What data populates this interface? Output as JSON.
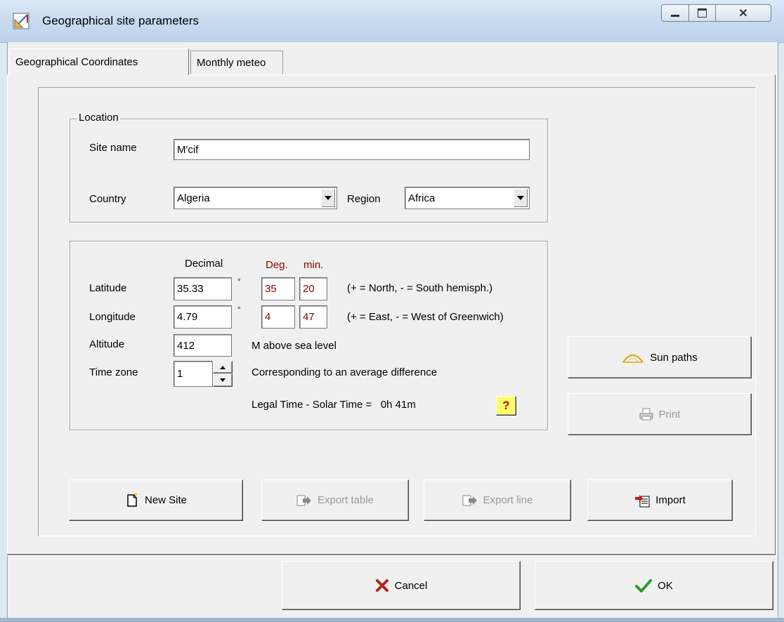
{
  "window": {
    "title": "Geographical site parameters",
    "controls": {
      "minimize": "minimize",
      "maximize": "maximize",
      "close": "close"
    }
  },
  "tabs": [
    {
      "label": "Geographical Coordinates",
      "active": true
    },
    {
      "label": "Monthly meteo",
      "active": false
    }
  ],
  "location": {
    "legend": "Location",
    "site_name_label": "Site name",
    "site_name_value": "M'cif",
    "country_label": "Country",
    "country_value": "Algeria",
    "region_label": "Region",
    "region_value": "Africa"
  },
  "coordinates": {
    "header_decimal": "Decimal",
    "header_deg": "Deg.",
    "header_min": "min.",
    "degree_symbol": "°",
    "latitude": {
      "label": "Latitude",
      "decimal": "35.33",
      "deg": "35",
      "min": "20",
      "hint": "(+ = North,  - = South hemisph.)"
    },
    "longitude": {
      "label": "Longitude",
      "decimal": "4.79",
      "deg": "4",
      "min": "47",
      "hint": "(+ = East, - = West of Greenwich)"
    },
    "altitude": {
      "label": "Altitude",
      "value": "412",
      "unit": "M above sea level"
    },
    "timezone": {
      "label": "Time zone",
      "value": "1",
      "note": "Corresponding to an average difference"
    },
    "legal_time": "Legal Time - Solar Time =   0h 41m",
    "help_glyph": "?"
  },
  "side_buttons": {
    "sun_paths": "Sun paths",
    "print": "Print"
  },
  "bottom_buttons": {
    "new_site": "New Site",
    "export_table": "Export table",
    "export_line": "Export line",
    "import": "Import"
  },
  "dialog_buttons": {
    "cancel": "Cancel",
    "ok": "OK"
  },
  "colors": {
    "dialog_bg": "#f0f0f0",
    "deg_min_text": "#8b0000",
    "titlebar": "#c9dcf0",
    "help_bg": "#ffff66"
  },
  "icons": {
    "app": "drafting-icon",
    "sun_paths": "sun-arc-icon",
    "print": "printer-icon",
    "new_site": "new-document-icon",
    "export_table": "export-icon",
    "export_line": "export-icon",
    "import": "import-icon",
    "cancel": "x-mark-icon",
    "ok": "checkmark-icon",
    "help": "question-icon"
  }
}
